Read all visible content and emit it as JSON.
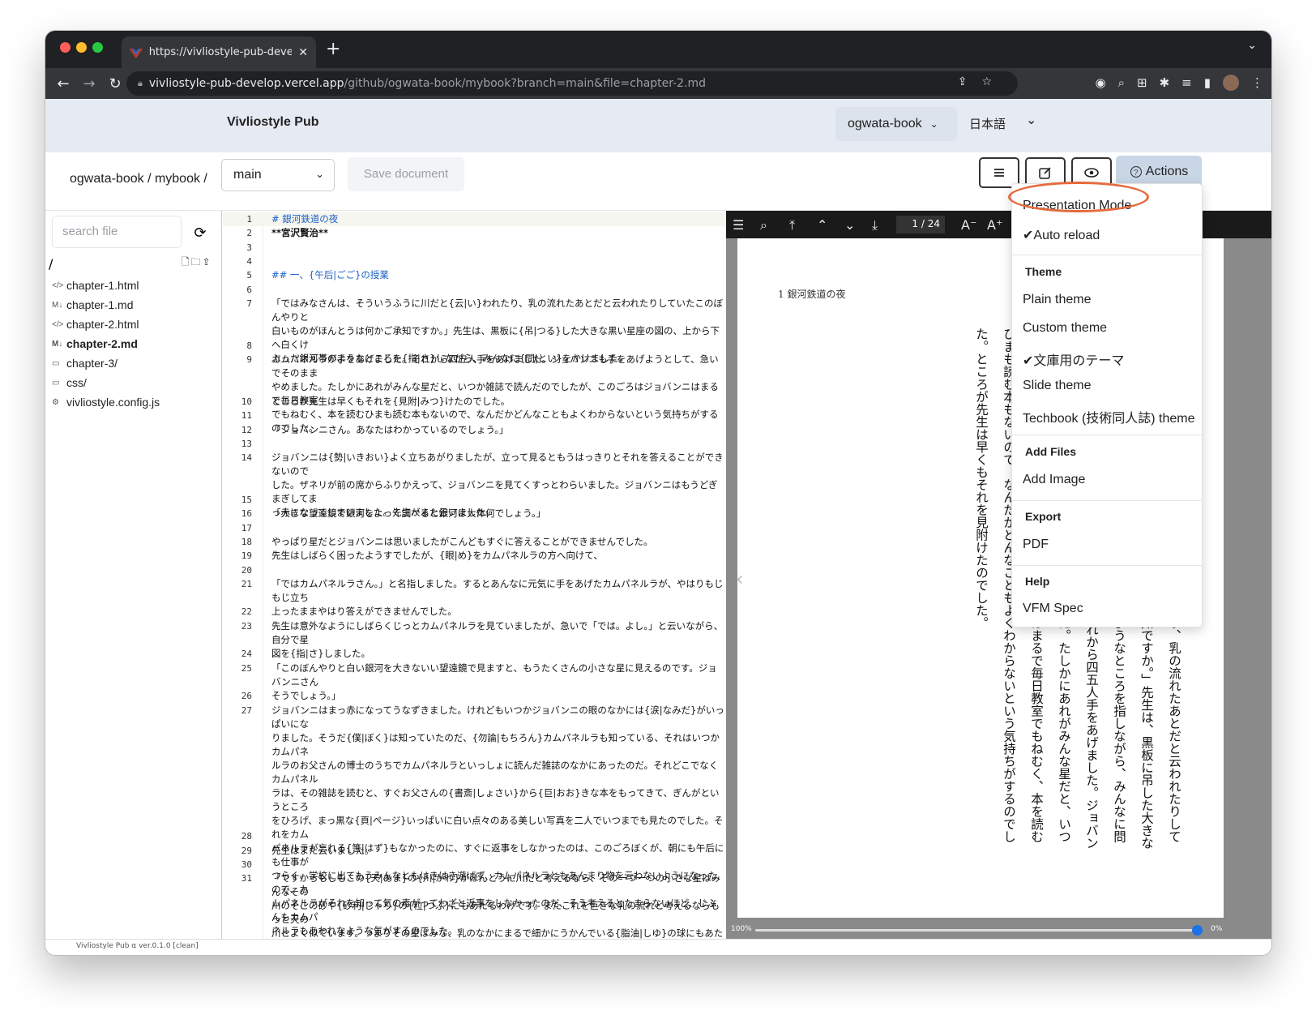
{
  "browser": {
    "tab_title": "https://vivliostyle-pub-develop",
    "new_tab": "+",
    "url_host": "vivliostyle-pub-develop.vercel.app",
    "url_path": "/github/ogwata-book/mybook?branch=main&file=chapter-2.md"
  },
  "app": {
    "brand": "Vivliostyle Pub",
    "account": "ogwata-book",
    "language": "日本語"
  },
  "toolbar": {
    "breadcrumb": "ogwata-book / mybook /",
    "branch": "main",
    "save_label": "Save document",
    "actions_label": "Actions"
  },
  "sidebar": {
    "search_placeholder": "search file",
    "root": "/",
    "files": [
      {
        "icon": "code-icon",
        "glyph": "</>",
        "name": "chapter-1.html",
        "active": false
      },
      {
        "icon": "markdown-icon",
        "glyph": "M↓",
        "name": "chapter-1.md",
        "active": false
      },
      {
        "icon": "code-icon",
        "glyph": "</>",
        "name": "chapter-2.html",
        "active": false
      },
      {
        "icon": "markdown-icon",
        "glyph": "M↓",
        "name": "chapter-2.md",
        "active": true
      },
      {
        "icon": "folder-icon",
        "glyph": "▭",
        "name": "chapter-3/",
        "active": false
      },
      {
        "icon": "folder-icon",
        "glyph": "▭",
        "name": "css/",
        "active": false
      },
      {
        "icon": "gear-icon",
        "glyph": "⚙",
        "name": "vivliostyle.config.js",
        "active": false
      }
    ]
  },
  "editor": {
    "lines": [
      {
        "n": "1",
        "t": "# 銀河鉄道の夜",
        "c": "h"
      },
      {
        "n": "2",
        "t": "**宮沢賢治**",
        "c": "b"
      },
      {
        "n": "3",
        "t": "",
        "c": ""
      },
      {
        "n": "4",
        "t": "",
        "c": ""
      },
      {
        "n": "5",
        "t": "## 一、{午后|ごご}の授業",
        "c": "h"
      },
      {
        "n": "6",
        "t": "",
        "c": ""
      },
      {
        "n": "7",
        "t": "「ではみなさんは、そういうふうに川だと{云|い}われたり、乳の流れたあとだと云われたりしていたこのぼんやりと\n白いものがほんとうは何かご承知ですか。」先生は、黒板に{吊|つる}した大きな黒い星座の図の、上から下へ白くけ\nぶった銀河帯のようなところを{指|さ}しながら、みんなに{問|とい}をかけました。",
        "c": ""
      },
      {
        "n": "8",
        "t": "",
        "c": ""
      },
      {
        "n": "9",
        "t": "カムパネルラが手をあげました。それから四五人手をあげました。ジョバンニも手をあげようとして、急いでそのまま\nやめました。たしかにあれがみんな星だと、いつか雑誌で読んだのでしたが、このごろはジョバンニはまるで毎日教室\nでもねむく、本を読むひまも読む本もないので、なんだかどんなこともよくわからないという気持ちがするのでした。",
        "c": ""
      },
      {
        "n": "10",
        "t": "ところが先生は早くもそれを{見附|みつ}けたのでした。",
        "c": ""
      },
      {
        "n": "11",
        "t": "",
        "c": ""
      },
      {
        "n": "12",
        "t": "「ジョバンニさん。あなたはわかっているのでしょう。」",
        "c": ""
      },
      {
        "n": "13",
        "t": "",
        "c": ""
      },
      {
        "n": "14",
        "t": "ジョバンニは{勢|いきおい}よく立ちあがりましたが、立って見るともうはっきりとそれを答えることができないので\nした。ザネリが前の席からふりかえって、ジョバンニを見てくすっとわらいました。ジョバンニはもうどぎまぎしてま\nっ赤になってしまいました。先生がまた云いました。",
        "c": ""
      },
      {
        "n": "15",
        "t": "",
        "c": ""
      },
      {
        "n": "16",
        "t": "「大きな望遠鏡で銀河をよっく調べると銀河は大体何でしょう。」",
        "c": ""
      },
      {
        "n": "17",
        "t": "",
        "c": ""
      },
      {
        "n": "18",
        "t": "やっぱり星だとジョバンニは思いましたがこんどもすぐに答えることができませんでした。",
        "c": ""
      },
      {
        "n": "19",
        "t": "先生はしばらく困ったようすでしたが、{眼|め}をカムパネルラの方へ向けて、",
        "c": ""
      },
      {
        "n": "20",
        "t": "",
        "c": ""
      },
      {
        "n": "21",
        "t": "「ではカムパネルラさん。」と名指しました。するとあんなに元気に手をあげたカムパネルラが、やはりもじもじ立ち\n上ったままやはり答えができませんでした。",
        "c": ""
      },
      {
        "n": "22",
        "t": "",
        "c": ""
      },
      {
        "n": "23",
        "t": "先生は意外なようにしばらくじっとカムパネルラを見ていましたが、急いで「では。よし。」と云いながら、自分で星\n図を{指|さ}しました。",
        "c": ""
      },
      {
        "n": "24",
        "t": "",
        "c": ""
      },
      {
        "n": "25",
        "t": "「このぼんやりと白い銀河を大きないい望遠鏡で見ますと、もうたくさんの小さな星に見えるのです。ジョバンニさん\nそうでしょう。」",
        "c": ""
      },
      {
        "n": "26",
        "t": "",
        "c": ""
      },
      {
        "n": "27",
        "t": "ジョバンニはまっ赤になってうなずきました。けれどもいつかジョバンニの眼のなかには{涙|なみだ}がいっぱいにな\nりました。そうだ{僕|ぼく}は知っていたのだ、{勿論|もちろん}カムパネルラも知っている、それはいつかカムパネ\nルラのお父さんの博士のうちでカムパネルラといっしょに読んだ雑誌のなかにあったのだ。それどこでなくカムパネル\nラは、その雑誌を読むと、すぐお父さんの{書斎|しょさい}から{巨|おお}きな本をもってきて、ぎんがというところ\nをひろげ、まっ黒な{頁|ページ}いっぱいに白い点々のある美しい写真を二人でいつまでも見たのでした。それをカム\nパネルラが忘れる{筈|はず}もなかったのに、すぐに返事をしなかったのは、このごろぼくが、朝にも午后にも仕事が\nつらく、学校に出てもうみんなともはきはき遊ばず、カムパネルラともあんまり物を云わないようになったので、カ\nムパネルラがそれを知って気の毒がってわざと返事をしなかったのだ、そう考えるとたまらないほど、じぶんもカムパ\nネルラもあわれなような気がするのでした。",
        "c": ""
      },
      {
        "n": "28",
        "t": "",
        "c": ""
      },
      {
        "n": "29",
        "t": "先生はまた云いました。",
        "c": ""
      },
      {
        "n": "30",
        "t": "",
        "c": ""
      },
      {
        "n": "31",
        "t": "「ですからもしもこの{天|あま}の{川|がわ}がほんとうに川だと考えるなら、その一つ一つの小さな星はみんなその\n川のそこの砂や{砂利|じゃり}の{粒|つぶ}にもあたるわけです。またこれを巨きな乳の流れと考えるならもっと天の\n川とよく似ています。つまりその星はみな、乳のなかにまるで細かにうかんでいる{脂油|しゆ}の球にもあたるので\nす。そんなら何がその川の水にあたるかと云いますと、それは真空という光をある速さで伝えるもので、太陽や地球も\nやっぱりそのなかに{浮|うか}んでいるのです。つまりは私どもも天の川の水のなかに{棲|す}んでいるわけです。そ",
        "c": ""
      }
    ]
  },
  "preview": {
    "page_indicator": "1 / 24",
    "page_current": "1",
    "page_total": "/ 24",
    "running_header": "1  銀河鉄道の夜",
    "body": "「ではみなさんは、そういうふうに川だと云われたり、乳の流れたあとだと云われたりしていたこのぼんやりと白いものがほんとうは何かご承知ですか。」先生は、黒板に吊した大きな黒い星座の図の、上から下へ白くけぶった銀河帯のようなところを指しながら、みんなに問をかけました。　カムパネルラが手をあげました。それから四五人手をあげました。ジョバンニも手をあげようとして、急いでそのままやめました。たしかにあれがみんな星だと、いつか雑誌で読んだのでしたが、このごろはジョバンニはまるで毎日教室でもねむく、本を読むひまも読む本もないので、なんだかどんなこともよくわからないという気持ちがするのでした。ところが先生は早くもそれを見附けたのでした。",
    "zoom_left": "100%",
    "zoom_right": "0%",
    "zoom_level": 0.99
  },
  "menu": {
    "presentation_mode": "Presentation Mode",
    "auto_reload": "✔Auto reload",
    "theme_header": "Theme",
    "themes": [
      "Plain theme",
      "Custom theme",
      "✔文庫用のテーマ",
      "Slide theme",
      "Techbook (技術同人誌) theme"
    ],
    "add_files_header": "Add Files",
    "add_image": "Add Image",
    "export_header": "Export",
    "pdf": "PDF",
    "help_header": "Help",
    "vfm_spec": "VFM Spec"
  },
  "footer": {
    "version": "Vivliostyle Pub α ver.0.1.0 [clean]"
  },
  "colors": {
    "header_bg": "#e6ebf3",
    "accent": "#1a73e8",
    "annotation_oval": "#e66a3c",
    "heading_blue": "#1a5fc4"
  }
}
